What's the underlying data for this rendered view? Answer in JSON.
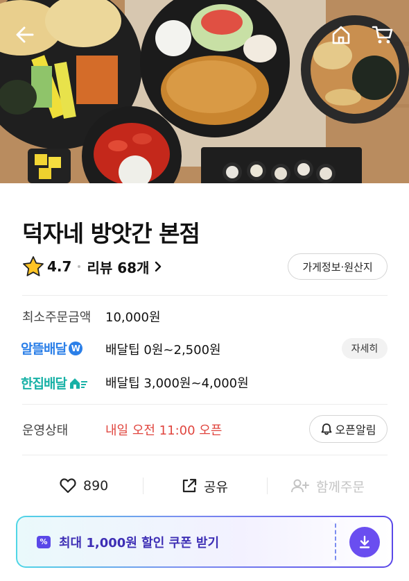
{
  "store": {
    "name": "덕자네 방앗간 본점",
    "rating": "4.7",
    "review_label": "리뷰 68개",
    "info_button": "가게정보·원산지"
  },
  "delivery": {
    "min_order_label": "최소주문금액",
    "min_order_value": "10,000원",
    "alddeul_label": "알뜰배달",
    "alddeul_badge": "W",
    "alddeul_tip": "배달팁 0원~2,500원",
    "detail_button": "자세히",
    "hanjip_label": "한집배달",
    "hanjip_tip": "배달팁 3,000원~4,000원"
  },
  "status": {
    "label": "운영상태",
    "value": "내일 오전 11:00 오픈",
    "alarm_button": "오픈알림"
  },
  "actions": {
    "like_count": "890",
    "share_label": "공유",
    "group_label": "함께주문"
  },
  "coupon": {
    "badge": "%",
    "text": "최대 1,000원 할인 쿠폰 받기"
  },
  "icons": {
    "back": "back-arrow-icon",
    "home": "home-icon",
    "cart": "cart-icon",
    "star": "star-icon",
    "heart": "heart-icon",
    "share": "share-icon",
    "group": "add-person-icon",
    "bell": "bell-icon",
    "download": "download-icon"
  },
  "colors": {
    "accent_purple": "#6a4ef0",
    "status_red": "#e0453e",
    "alddeul_blue": "#2b7fe8",
    "hanjip_teal": "#18b1a6"
  }
}
